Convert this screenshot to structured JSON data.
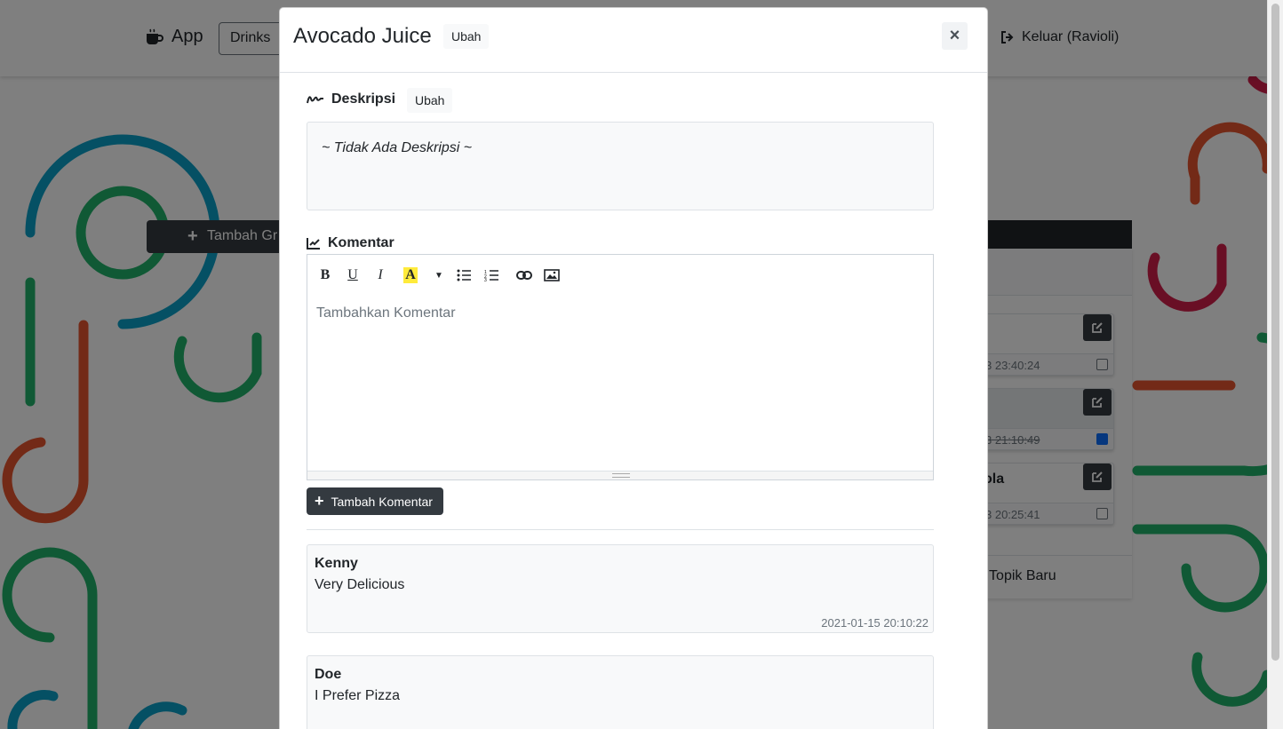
{
  "navbar": {
    "brand": "App",
    "drinks_label": "Drinks",
    "logout_label": "Keluar (Ravioli)"
  },
  "background": {
    "add_group_label": "Tambah Gr",
    "topics": [
      {
        "name": "",
        "time": "3 23:40:24",
        "done": false
      },
      {
        "name": "",
        "time": "3 21:10:49",
        "done": true
      },
      {
        "name": "ola",
        "time": "3 20:25:41",
        "done": false
      }
    ],
    "new_topic_label": "h Topik Baru"
  },
  "modal": {
    "title": "Avocado Juice",
    "title_edit_label": "Ubah",
    "close_label": "×",
    "description": {
      "heading": "Deskripsi",
      "edit_label": "Ubah",
      "text": "~ Tidak Ada Deskripsi ~"
    },
    "comments_section": {
      "heading": "Komentar",
      "placeholder": "Tambahkan Komentar",
      "add_button_label": "Tambah Komentar"
    },
    "comments": [
      {
        "author": "Kenny",
        "text": "Very Delicious",
        "time": "2021-01-15 20:10:22"
      },
      {
        "author": "Doe",
        "text": "I Prefer Pizza",
        "time": ""
      }
    ]
  },
  "colors": {
    "dark": "#343a40",
    "blue_decor": "#0aa0c8",
    "green_decor": "#21b36b",
    "orange_decor": "#e6552e",
    "red_decor": "#d21f4b",
    "highlight": "#ffeb3b"
  }
}
